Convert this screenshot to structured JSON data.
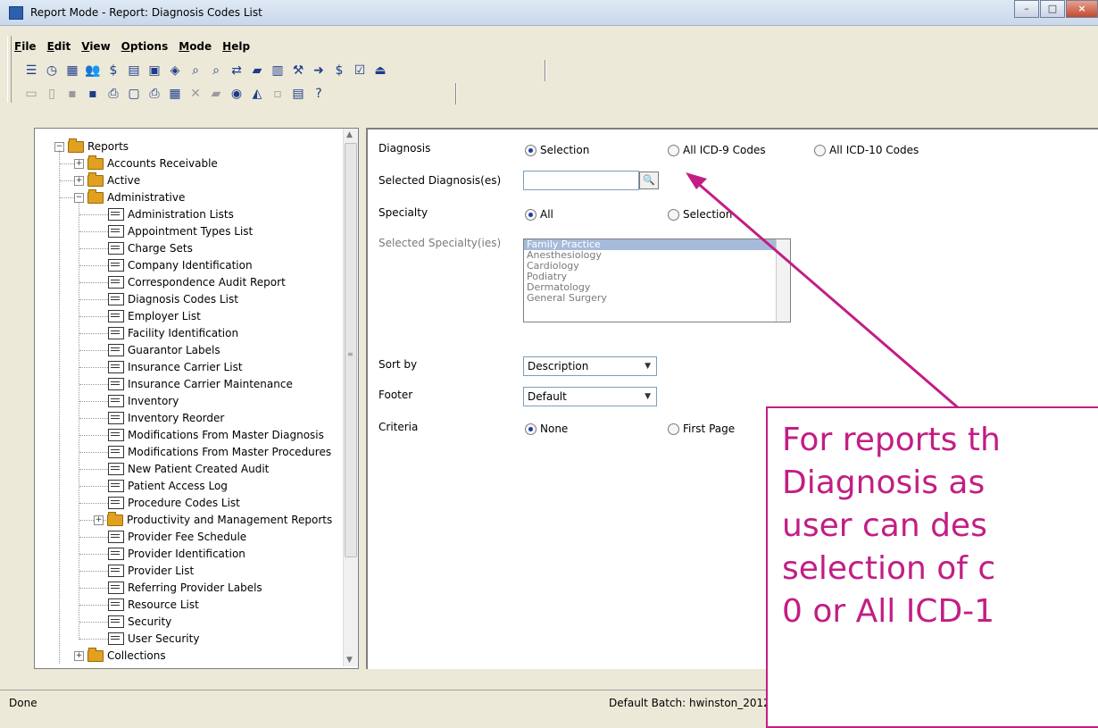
{
  "window": {
    "title": "Report Mode - Report: Diagnosis Codes List"
  },
  "menu": [
    "File",
    "Edit",
    "View",
    "Options",
    "Mode",
    "Help"
  ],
  "toolbar1": [
    "list-icon",
    "clock-icon",
    "grid-icon",
    "users-icon",
    "dollar-icon",
    "ledger-icon",
    "calculator-icon",
    "payment-icon",
    "search-patient-icon",
    "search-icon",
    "transfer-icon",
    "folder-open-icon",
    "document-icon",
    "wrench-icon",
    "export-icon",
    "chart-dollar-icon",
    "checklist-icon",
    "exit-icon"
  ],
  "toolbar2": [
    "new-folder-icon",
    "new-document-icon",
    "save-disabled-icon",
    "save-icon",
    "print-icon",
    "preview-icon",
    "printer-icon",
    "print-setup-icon",
    "delete-icon",
    "folder-icon",
    "headset-icon",
    "chart-icon",
    "clear-icon",
    "report-icon",
    "help-icon"
  ],
  "tree": {
    "root": "Reports",
    "groups": [
      {
        "label": "Accounts Receivable",
        "expanded": false
      },
      {
        "label": "Active",
        "expanded": false
      },
      {
        "label": "Administrative",
        "expanded": true
      }
    ],
    "items": [
      "Administration Lists",
      "Appointment Types List",
      "Charge Sets",
      "Company Identification",
      "Correspondence Audit Report",
      "Diagnosis Codes List",
      "Employer List",
      "Facility Identification",
      "Guarantor Labels",
      "Insurance Carrier List",
      "Insurance Carrier Maintenance",
      "Inventory",
      "Inventory Reorder",
      "Modifications From Master Diagnosis",
      "Modifications From Master Procedures",
      "New Patient Created Audit",
      "Patient Access Log",
      "Procedure Codes List",
      "Productivity and Management Reports",
      "Provider Fee Schedule",
      "Provider Identification",
      "Provider List",
      "Referring Provider Labels",
      "Resource List",
      "Security",
      "User Security"
    ],
    "cut_item": "Collections"
  },
  "form": {
    "diagnosis_label": "Diagnosis",
    "diagnosis_options": [
      "Selection",
      "All ICD-9 Codes",
      "All ICD-10 Codes"
    ],
    "diagnosis_selected": "Selection",
    "selected_diagnoses_label": "Selected Diagnosis(es)",
    "selected_diagnoses_value": "",
    "specialty_label": "Specialty",
    "specialty_options": [
      "All",
      "Selection"
    ],
    "specialty_selected": "All",
    "selected_specialties_label": "Selected Specialty(ies)",
    "specialties": [
      "Family Practice",
      "Anesthesiology",
      "Cardiology",
      "Podiatry",
      "Dermatology",
      "General Surgery"
    ],
    "specialty_highlighted": "Family Practice",
    "sortby_label": "Sort by",
    "sortby_value": "Description",
    "footer_label": "Footer",
    "footer_value": "Default",
    "criteria_label": "Criteria",
    "criteria_options": [
      "None",
      "First Page"
    ],
    "criteria_selected": "None"
  },
  "status": {
    "left": "Done",
    "right": "Default Batch: hwinston_2012"
  },
  "annotation": {
    "lines": [
      "For reports th",
      "Diagnosis as",
      "user can des",
      "selection of c",
      "0 or All ICD-1"
    ],
    "color": "#c21e84"
  }
}
